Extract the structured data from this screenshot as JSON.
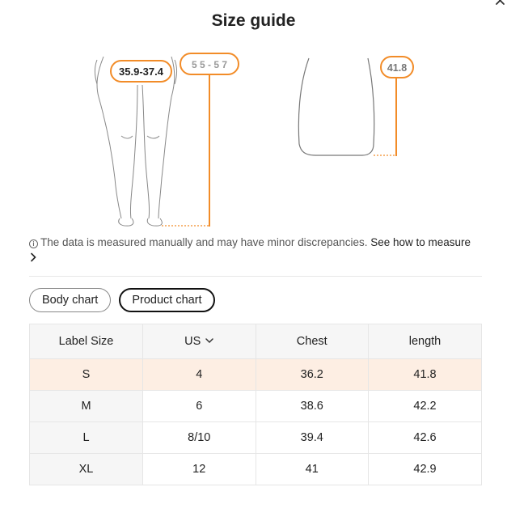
{
  "modal": {
    "title": "Size guide"
  },
  "illustration": {
    "body_callout_hip": "35.9-37.4",
    "body_callout_length": "5 5 - 5 7",
    "product_callout_length": "41.8",
    "accent_color": "#f28c28"
  },
  "disclaimer": {
    "text": "The data is measured manually and may have minor discrepancies.",
    "link": "See how to measure"
  },
  "tabs": [
    {
      "label": "Body chart",
      "active": false
    },
    {
      "label": "Product chart",
      "active": true
    }
  ],
  "table": {
    "headers": [
      "Label Size",
      "US",
      "Chest",
      "length"
    ],
    "rows": [
      [
        "S",
        "4",
        "36.2",
        "41.8"
      ],
      [
        "M",
        "6",
        "38.6",
        "42.2"
      ],
      [
        "L",
        "8/10",
        "39.4",
        "42.6"
      ],
      [
        "XL",
        "12",
        "41",
        "42.9"
      ]
    ],
    "highlight_row_color": "#fdeee3"
  }
}
